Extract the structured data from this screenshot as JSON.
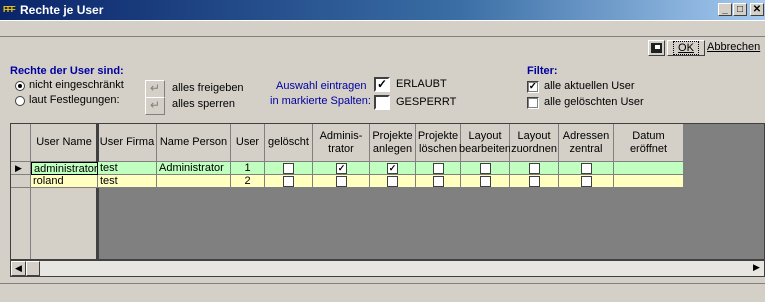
{
  "window": {
    "title": "Rechte je User",
    "min_glyph": "_",
    "max_glyph": "□",
    "close_glyph": "✕"
  },
  "toolbar": {
    "ok_label": "OK",
    "cancel_label": "Abbrechen"
  },
  "rights": {
    "header": "Rechte der User sind:",
    "radio_unrestricted": "nicht eingeschränkt",
    "radio_by_settings": "laut Festlegungen:",
    "selected": "unrestricted",
    "release_all": "alles freigeben",
    "lock_all": "alles sperren"
  },
  "apply": {
    "line1": "Auswahl eintragen",
    "line2": "in markierte Spalten:",
    "allowed_label": "ERLAUBT",
    "allowed_checked": true,
    "locked_label": "GESPERRT",
    "locked_checked": false
  },
  "filter": {
    "header": "Filter:",
    "current_users_label": "alle aktuellen User",
    "current_users_checked": true,
    "deleted_users_label": "alle gelöschten User",
    "deleted_users_checked": false
  },
  "grid": {
    "columns": [
      "User Name",
      "User Firma",
      "Name Person",
      "User",
      "gelöscht",
      "Adminis-\ntrator",
      "Projekte\nanlegen",
      "Projekte\nlöschen",
      "Layout\nbearbeiten",
      "Layout\nzuordnen",
      "Adressen\nzentral",
      "Datum\neröffnet"
    ],
    "rows": [
      {
        "user_name": "administrator",
        "firma": "test",
        "person": "Administrator",
        "user": "1",
        "geloescht": false,
        "admin": true,
        "proj_anlegen": true,
        "proj_loeschen": false,
        "layout_bearb": false,
        "layout_zuord": false,
        "adressen": false,
        "datum": ""
      },
      {
        "user_name": "roland",
        "firma": "test",
        "person": "",
        "user": "2",
        "geloescht": false,
        "admin": false,
        "proj_anlegen": false,
        "proj_loeschen": false,
        "layout_bearb": false,
        "layout_zuord": false,
        "adressen": false,
        "datum": ""
      }
    ],
    "current_row_marker": "▶"
  },
  "colors": {
    "row_green": "#c0ffc0",
    "row_yellow": "#ffffc0",
    "header_blue": "#0000a0"
  }
}
